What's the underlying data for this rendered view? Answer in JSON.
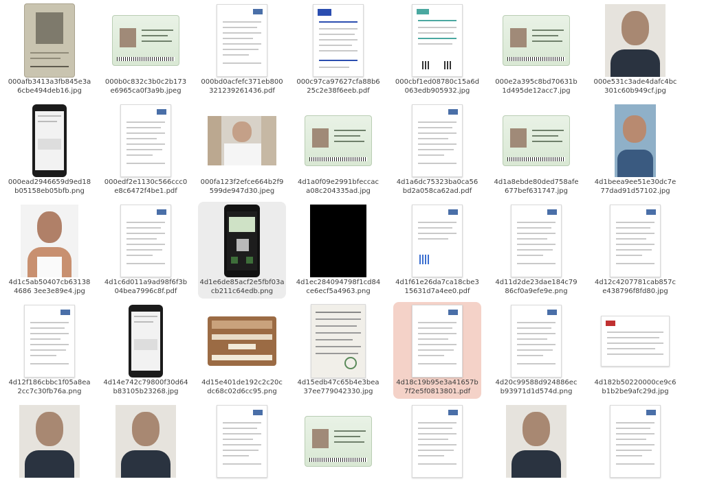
{
  "files": [
    {
      "name": "000afb3413a3fb845e3a6cbe494deb16.jpg",
      "thumb": "passport"
    },
    {
      "name": "000b0c832c3b0c2b173e6965ca0f3a9b.jpeg",
      "thumb": "green-card"
    },
    {
      "name": "000bd0acfefc371eb800321239261436.pdf",
      "thumb": "doc"
    },
    {
      "name": "000c97ca97627cfa88b625c2e38f6eeb.pdf",
      "thumb": "doc-blue"
    },
    {
      "name": "000cbf1ed08780c15a6d063edb905932.jpg",
      "thumb": "doc-teal"
    },
    {
      "name": "000e2a395c8bd70631b1d495de12acc7.jpg",
      "thumb": "green-card"
    },
    {
      "name": "000e531c3ade4dafc4bc301c60b949cf.jpg",
      "thumb": "portrait"
    },
    {
      "name": "000ead2946659d9ed18b05158eb05bfb.png",
      "thumb": "phone"
    },
    {
      "name": "000edf2e1130c566ccc0e8c6472f4be1.pdf",
      "thumb": "doc"
    },
    {
      "name": "000fa123f2efce664b2f9599de947d30.jpeg",
      "thumb": "crowd"
    },
    {
      "name": "4d1a0f09e2991bfeccaca08c204335ad.jpg",
      "thumb": "green-card"
    },
    {
      "name": "4d1a6dc75323ba0ca56bd2a058ca62ad.pdf",
      "thumb": "doc"
    },
    {
      "name": "4d1a8ebde80ded758afe677bef631747.jpg",
      "thumb": "green-card"
    },
    {
      "name": "4d1beea9ee51e30dc7e77dad91d57102.jpg",
      "thumb": "selfie"
    },
    {
      "name": "4d1c5ab50407cb631384686 3ee3e89e4.jpg",
      "thumb": "portrait-white"
    },
    {
      "name": "4d1c6d011a9ad98f6f3b04bea7996c8f.pdf",
      "thumb": "doc"
    },
    {
      "name": "4d1e6de85acf2e5fbf03acb211c64edb.png",
      "thumb": "phone-green"
    },
    {
      "name": "4d1ec284094798f1cd84ce6ecf5a4963.png",
      "thumb": "black"
    },
    {
      "name": "4d1f61e26da7ca18cbe315631d7a4ee0.pdf",
      "thumb": "doc-qr"
    },
    {
      "name": "4d11d2de23dae184c7986cf0a9efe9e.png",
      "thumb": "doc"
    },
    {
      "name": "4d12c4207781cab857ce438796f8fd80.jpg",
      "thumb": "doc"
    },
    {
      "name": "4d12f186cbbc1f05a8ea2cc7c30fb76a.png",
      "thumb": "doc"
    },
    {
      "name": "4d14e742c79800f30d64b83105b23268.jpg",
      "thumb": "phone"
    },
    {
      "name": "4d15e401de192c2c20cdc68c02d6cc95.png",
      "thumb": "bank-card"
    },
    {
      "name": "4d15edb47c65b4e3bea37ee779042330.jpg",
      "thumb": "receipt"
    },
    {
      "name": "4d18c19b95e3a41657b7f2e5f0813801.pdf",
      "thumb": "doc"
    },
    {
      "name": "4d20c99588d924886ecb93971d1d574d.png",
      "thumb": "doc"
    },
    {
      "name": "4d182b50220000ce9c6b1b2be9afc29d.jpg",
      "thumb": "doc-wide"
    }
  ],
  "partial_row_count": 8,
  "hover_index": 16,
  "selected_index": 25,
  "colors": {
    "selected_bg": "#f4d2c8",
    "hover_bg": "#ececec",
    "label": "#3c3c3c"
  }
}
